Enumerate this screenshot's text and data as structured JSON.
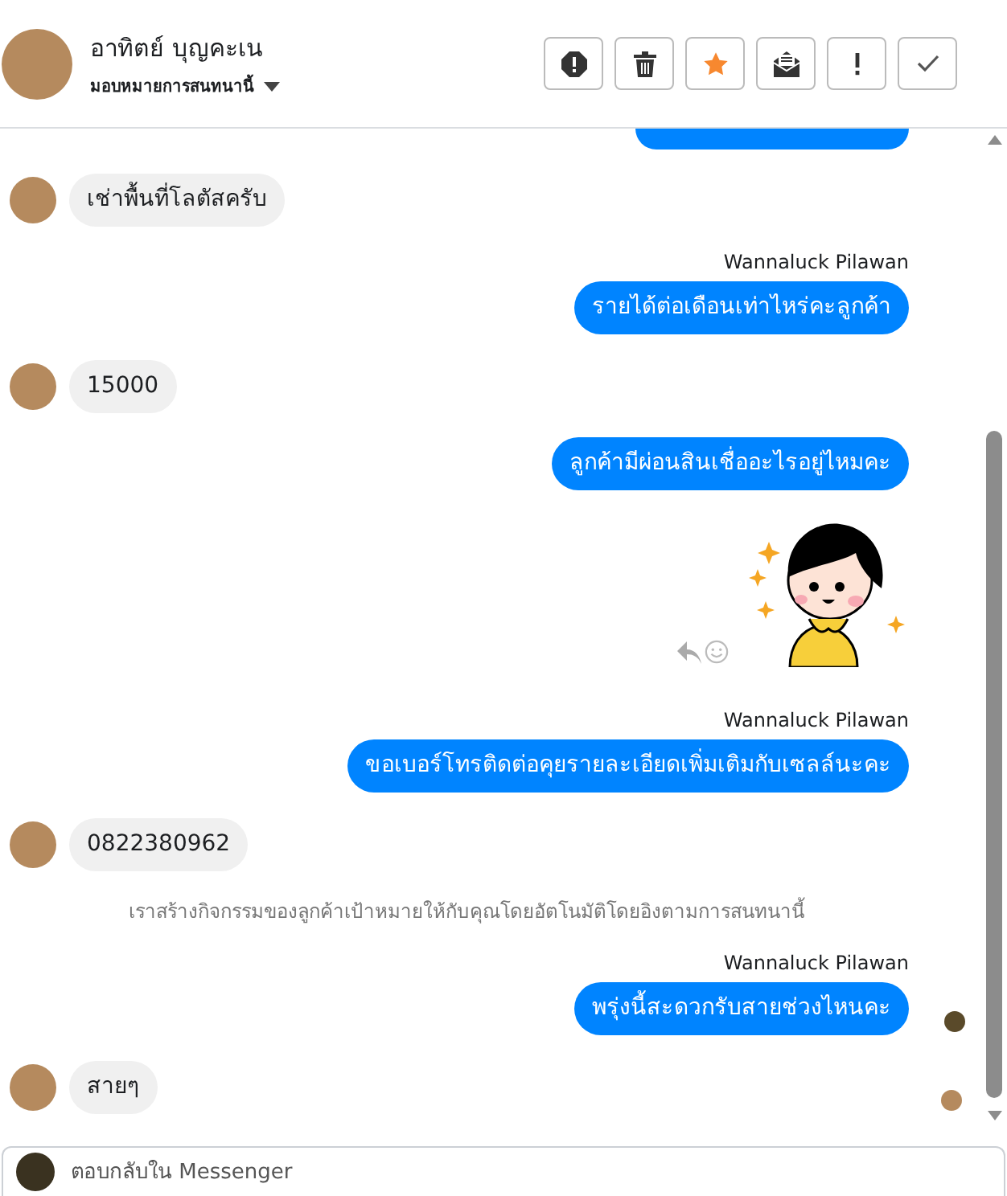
{
  "header": {
    "name": "อาทิตย์ บุญคะเน",
    "assign_label": "มอบหมายการสนทนานี้"
  },
  "toolbar": [
    {
      "kind": "block",
      "on": false
    },
    {
      "kind": "delete",
      "on": false
    },
    {
      "kind": "star",
      "on": true
    },
    {
      "kind": "unread",
      "on": false
    },
    {
      "kind": "important",
      "on": false
    },
    {
      "kind": "done",
      "on": false
    }
  ],
  "messages": [
    {
      "kind": "outgoing_cut"
    },
    {
      "kind": "incoming",
      "text": "เช่าพื้นที่โลตัสครับ"
    },
    {
      "kind": "outgoing",
      "sender": "Wannaluck Pilawan",
      "text": "รายได้ต่อเดือนเท่าไหร่คะลูกค้า",
      "seen": false
    },
    {
      "kind": "incoming",
      "text": "15000"
    },
    {
      "kind": "outgoing",
      "text": "ลูกค้ามีผ่อนสินเชื่ออะไรอยู่ไหมคะ",
      "seen": false
    },
    {
      "kind": "sticker"
    },
    {
      "kind": "outgoing",
      "sender": "Wannaluck Pilawan",
      "text": "ขอเบอร์โทรติดต่อคุยรายละเอียดเพิ่มเติมกับเซลล์นะคะ",
      "seen": false
    },
    {
      "kind": "incoming",
      "text": "0822380962"
    },
    {
      "kind": "system",
      "text": "เราสร้างกิจกรรมของลูกค้าเป้าหมายให้กับคุณโดยอัตโนมัติโดยอิงตามการสนทนานี้"
    },
    {
      "kind": "outgoing",
      "sender": "Wannaluck Pilawan",
      "text": "พรุ่งนี้สะดวกรับสายช่วงไหนคะ",
      "seen": true
    },
    {
      "kind": "incoming",
      "text": "สายๆ",
      "seen": true
    }
  ],
  "composer": {
    "placeholder": "ตอบกลับใน Messenger"
  }
}
